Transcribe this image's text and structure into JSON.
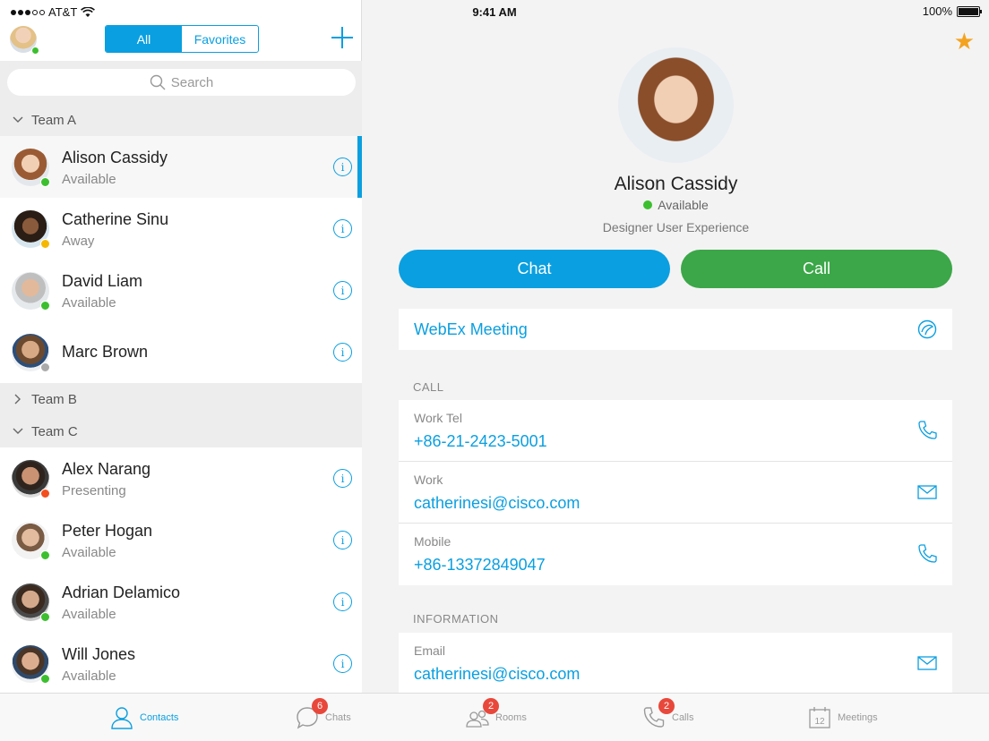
{
  "status_bar": {
    "carrier": "AT&T",
    "time": "9:41 AM",
    "battery": "100%"
  },
  "header": {
    "segments": [
      "All",
      "Favorites"
    ],
    "active_segment": "All"
  },
  "search": {
    "placeholder": "Search"
  },
  "groups": [
    {
      "name": "Team A",
      "expanded": true
    },
    {
      "name": "Team B",
      "expanded": false
    },
    {
      "name": "Team C",
      "expanded": true
    }
  ],
  "contacts": [
    {
      "name": "Alison Cassidy",
      "status": "Available",
      "presence": "#3cbf2f"
    },
    {
      "name": "Catherine Sinu",
      "status": "Away",
      "presence": "#f5b800"
    },
    {
      "name": "David Liam",
      "status": "Available",
      "presence": "#3cbf2f"
    },
    {
      "name": "Marc Brown",
      "status": "",
      "presence": "#aaaaaa"
    },
    {
      "name": "Alex Narang",
      "status": "Presenting",
      "presence": "#f24e1e"
    },
    {
      "name": "Peter Hogan",
      "status": "Available",
      "presence": "#3cbf2f"
    },
    {
      "name": "Adrian Delamico",
      "status": "Available",
      "presence": "#3cbf2f"
    },
    {
      "name": "Will Jones",
      "status": "Available",
      "presence": "#3cbf2f"
    }
  ],
  "profile": {
    "name": "Alison Cassidy",
    "status": "Available",
    "title": "Designer User Experience",
    "chat_label": "Chat",
    "call_label": "Call",
    "webex_label": "WebEx Meeting",
    "call_section": "CALL",
    "info_section": "INFORMATION",
    "call_fields": [
      {
        "label": "Work Tel",
        "value": "+86-21-2423-5001",
        "icon": "phone-icon"
      },
      {
        "label": "Work",
        "value": "catherinesi@cisco.com",
        "icon": "mail-icon"
      },
      {
        "label": "Mobile",
        "value": "+86-13372849047",
        "icon": "phone-icon"
      }
    ],
    "info_fields": [
      {
        "label": "Email",
        "value": "catherinesi@cisco.com",
        "icon": "mail-icon"
      }
    ]
  },
  "tabs": [
    {
      "label": "Contacts",
      "badge": ""
    },
    {
      "label": "Chats",
      "badge": "6"
    },
    {
      "label": "Rooms",
      "badge": "2"
    },
    {
      "label": "Calls",
      "badge": "2"
    },
    {
      "label": "Meetings",
      "badge": "",
      "calendar_day": "12"
    }
  ],
  "colors": {
    "accent": "#0a9fe0",
    "call_green": "#3ba748",
    "favorite_star": "#f4a320",
    "badge": "#e8483b"
  }
}
